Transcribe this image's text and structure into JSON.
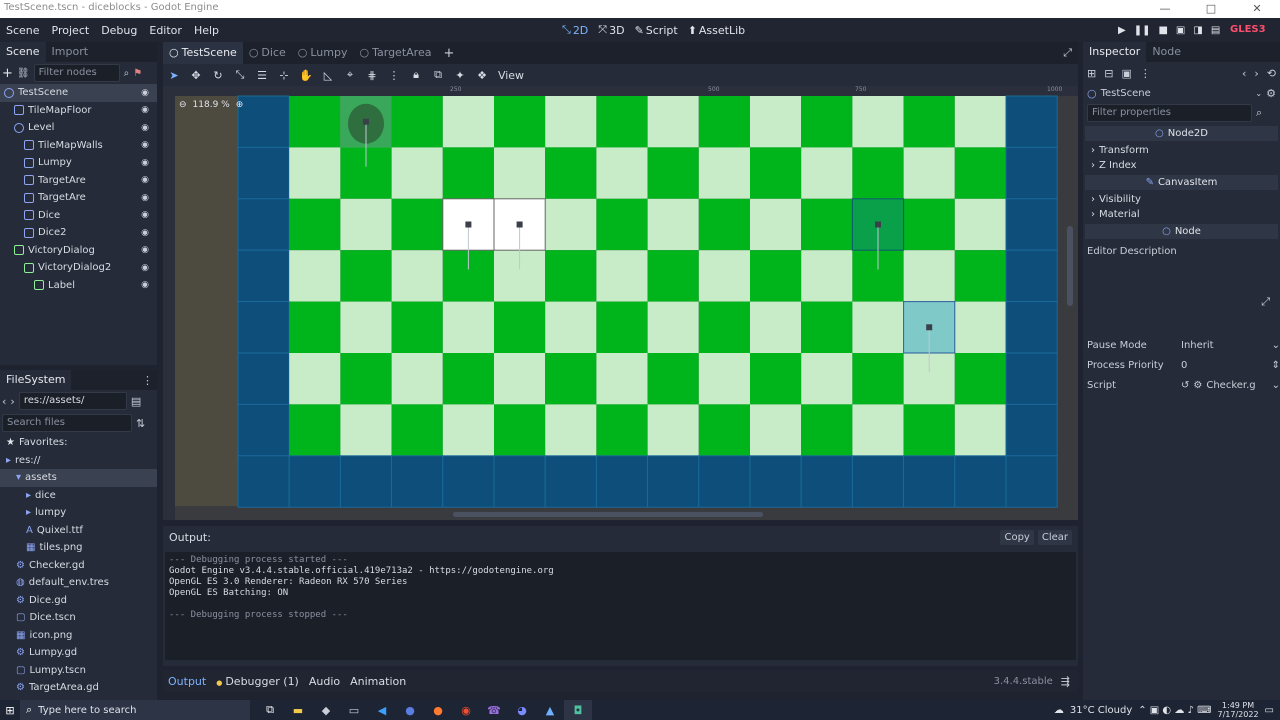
{
  "window": {
    "title": "TestScene.tscn - diceblocks - Godot Engine",
    "minimize": "—",
    "maximize": "□",
    "close": "✕"
  },
  "menu": {
    "items": [
      "Scene",
      "Project",
      "Debug",
      "Editor",
      "Help"
    ]
  },
  "workspaces": [
    {
      "label": "2D",
      "icon": "2d-icon",
      "glyph": "⤡",
      "active": true
    },
    {
      "label": "3D",
      "icon": "3d-icon",
      "glyph": "⤧",
      "active": false
    },
    {
      "label": "Script",
      "icon": "script-icon",
      "glyph": "✎",
      "active": false
    },
    {
      "label": "AssetLib",
      "icon": "assetlib-icon",
      "glyph": "⬆",
      "active": false
    }
  ],
  "play_buttons": [
    "▶",
    "❚❚",
    "■",
    "▣",
    "◨",
    "▤"
  ],
  "renderer": "GLES3",
  "scene_dock": {
    "tabs": [
      {
        "label": "Scene",
        "active": true
      },
      {
        "label": "Import",
        "active": false
      }
    ],
    "filter_placeholder": "Filter nodes",
    "nodes": [
      {
        "label": "TestScene",
        "depth": 0,
        "color": "#8da5f3",
        "selected": true
      },
      {
        "label": "TileMapFloor",
        "depth": 1,
        "color": "#8da5f3"
      },
      {
        "label": "Level",
        "depth": 1,
        "color": "#8da5f3"
      },
      {
        "label": "TileMapWalls",
        "depth": 2,
        "color": "#8da5f3"
      },
      {
        "label": "Lumpy",
        "depth": 2,
        "color": "#8da5f3"
      },
      {
        "label": "TargetAre",
        "depth": 2,
        "color": "#8da5f3"
      },
      {
        "label": "TargetAre",
        "depth": 2,
        "color": "#8da5f3"
      },
      {
        "label": "Dice",
        "depth": 2,
        "color": "#8da5f3"
      },
      {
        "label": "Dice2",
        "depth": 2,
        "color": "#8da5f3"
      },
      {
        "label": "VictoryDialog",
        "depth": 1,
        "color": "#8eef97"
      },
      {
        "label": "VictoryDialog2",
        "depth": 2,
        "color": "#8eef97"
      },
      {
        "label": "Label",
        "depth": 3,
        "color": "#8eef97"
      }
    ]
  },
  "filesystem": {
    "title": "FileSystem",
    "path": "res://assets/",
    "search_placeholder": "Search files",
    "items": [
      {
        "label": "Favorites:",
        "depth": 0,
        "icon": "★"
      },
      {
        "label": "res://",
        "depth": 0,
        "icon": "▸"
      },
      {
        "label": "assets",
        "depth": 1,
        "icon": "▾",
        "selected": true
      },
      {
        "label": "dice",
        "depth": 2,
        "icon": "▸"
      },
      {
        "label": "lumpy",
        "depth": 2,
        "icon": "▸"
      },
      {
        "label": "Quixel.ttf",
        "depth": 2,
        "icon": "A"
      },
      {
        "label": "tiles.png",
        "depth": 2,
        "icon": "▦"
      },
      {
        "label": "Checker.gd",
        "depth": 1,
        "icon": "⚙"
      },
      {
        "label": "default_env.tres",
        "depth": 1,
        "icon": "◍"
      },
      {
        "label": "Dice.gd",
        "depth": 1,
        "icon": "⚙"
      },
      {
        "label": "Dice.tscn",
        "depth": 1,
        "icon": "▢"
      },
      {
        "label": "icon.png",
        "depth": 1,
        "icon": "▦"
      },
      {
        "label": "Lumpy.gd",
        "depth": 1,
        "icon": "⚙"
      },
      {
        "label": "Lumpy.tscn",
        "depth": 1,
        "icon": "▢"
      },
      {
        "label": "TargetArea.gd",
        "depth": 1,
        "icon": "⚙"
      }
    ]
  },
  "editor_tabs": [
    {
      "label": "TestScene",
      "active": true
    },
    {
      "label": "Dice",
      "active": false
    },
    {
      "label": "Lumpy",
      "active": false
    },
    {
      "label": "TargetArea",
      "active": false
    }
  ],
  "toolbar": {
    "view_label": "View"
  },
  "viewport": {
    "zoom": "118.9 %",
    "zoom_minus": "⊖",
    "zoom_plus": "⊕",
    "ruler_marks": [
      "250",
      "500",
      "750",
      "1000"
    ],
    "ruler_v": [
      "250",
      "500"
    ]
  },
  "inspector": {
    "tabs": [
      {
        "label": "Inspector",
        "active": true
      },
      {
        "label": "Node",
        "active": false
      }
    ],
    "node_name": "TestScene",
    "filter_placeholder": "Filter properties",
    "sections": [
      {
        "kind": "header",
        "label": "Node2D"
      },
      {
        "kind": "category",
        "label": "Transform"
      },
      {
        "kind": "category",
        "label": "Z Index"
      },
      {
        "kind": "header",
        "label": "CanvasItem"
      },
      {
        "kind": "category",
        "label": "Visibility"
      },
      {
        "kind": "category",
        "label": "Material"
      },
      {
        "kind": "header",
        "label": "Node"
      }
    ],
    "editor_description": "Editor Description",
    "props": [
      {
        "label": "Pause Mode",
        "value": "Inherit"
      },
      {
        "label": "Process Priority",
        "value": "0"
      },
      {
        "label": "Script",
        "value": "Checker.g"
      }
    ]
  },
  "output": {
    "title": "Output:",
    "copy": "Copy",
    "clear": "Clear",
    "lines": [
      "--- Debugging process started ---",
      "Godot Engine v3.4.4.stable.official.419e713a2 - https://godotengine.org",
      "OpenGL ES 3.0 Renderer: Radeon RX 570 Series",
      "OpenGL ES Batching: ON",
      "",
      "--- Debugging process stopped ---"
    ]
  },
  "bottom_tabs": [
    {
      "label": "Output",
      "active": true
    },
    {
      "label": "Debugger (1)",
      "active": false
    },
    {
      "label": "Audio",
      "active": false
    },
    {
      "label": "Animation",
      "active": false
    }
  ],
  "version": "3.4.4.stable",
  "taskbar": {
    "search_placeholder": "Type here to search",
    "weather": "31°C  Cloudy",
    "time": "1:49 PM",
    "date": "7/17/2022",
    "apps": [
      {
        "glyph": "⧉",
        "color": "#ffffff"
      },
      {
        "glyph": "▬",
        "color": "#f2c94c"
      },
      {
        "glyph": "◆",
        "color": "#c9ced8"
      },
      {
        "glyph": "▭",
        "color": "#c9ced8"
      },
      {
        "glyph": "◀",
        "color": "#3aa0ff"
      },
      {
        "glyph": "●",
        "color": "#5b7ce0"
      },
      {
        "glyph": "●",
        "color": "#ff7a2f"
      },
      {
        "glyph": "◉",
        "color": "#f04e30"
      },
      {
        "glyph": "☎",
        "color": "#9b6fe0"
      },
      {
        "glyph": "◕",
        "color": "#7a8cff"
      },
      {
        "glyph": "▲",
        "color": "#6fb0ff"
      },
      {
        "glyph": "◘",
        "color": "#4fc3a0"
      }
    ]
  },
  "colors": {
    "dark_green": "#00b41c",
    "light_green": "#c8ecc8",
    "wall": "#0d4e7a",
    "accent": "#7cb3ff"
  }
}
